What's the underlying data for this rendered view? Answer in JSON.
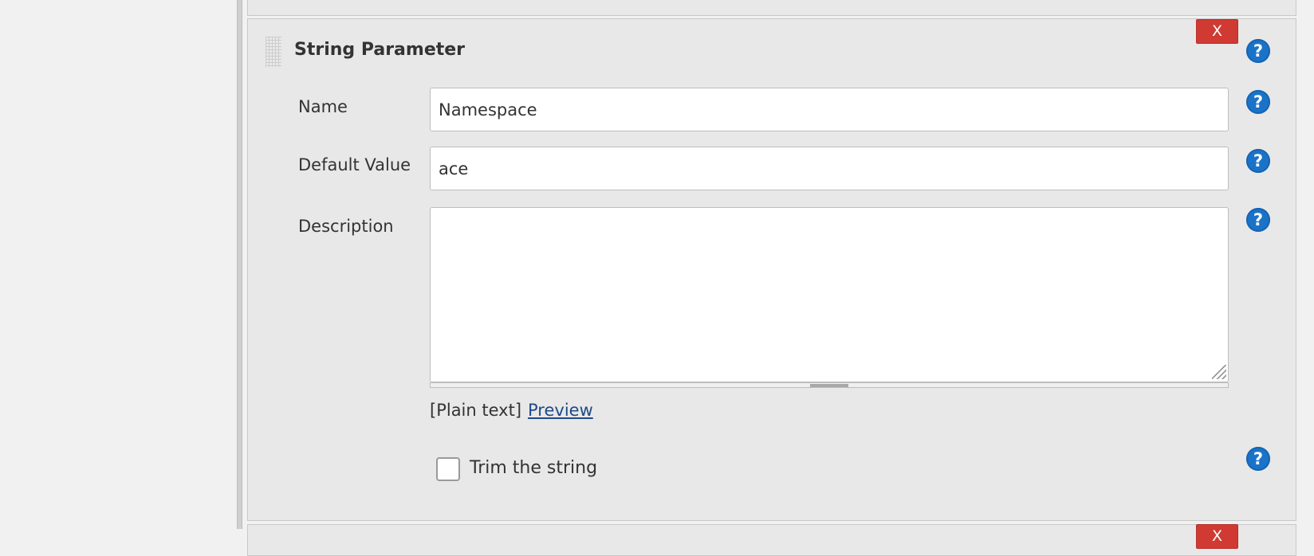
{
  "param_block": {
    "title": "String Parameter",
    "delete_label": "X",
    "name": {
      "label": "Name",
      "value": "Namespace"
    },
    "default_value": {
      "label": "Default Value",
      "value": "ace"
    },
    "description": {
      "label": "Description",
      "value": ""
    },
    "format": {
      "plain_text": "[Plain text]",
      "preview_link": "Preview"
    },
    "trim": {
      "label": "Trim the string",
      "checked": false
    },
    "help_glyph": "?"
  },
  "next_block": {
    "delete_label": "X"
  },
  "colors": {
    "delete": "#d03a33",
    "help": "#1a73c8",
    "link": "#204a87",
    "panel": "#e8e8e8"
  }
}
